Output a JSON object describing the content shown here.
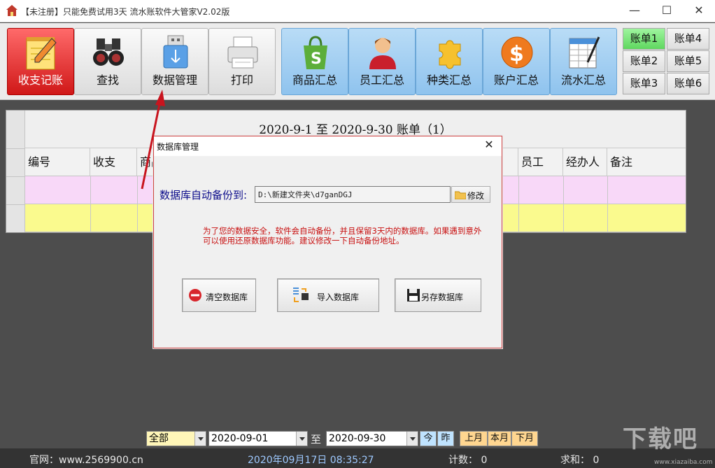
{
  "window": {
    "title": "【未注册】只能免费试用3天 流水账软件大管家V2.02版",
    "min_glyph": "—",
    "max_glyph": "☐",
    "close_glyph": "✕"
  },
  "toolbar": {
    "buttons": [
      {
        "label": "收支记账",
        "icon": "notepad-pencil-icon"
      },
      {
        "label": "查找",
        "icon": "binoculars-icon"
      },
      {
        "label": "数据管理",
        "icon": "usb-drive-icon"
      },
      {
        "label": "打印",
        "icon": "printer-icon"
      },
      {
        "label": "商品汇总",
        "icon": "shopping-bag-icon"
      },
      {
        "label": "员工汇总",
        "icon": "person-icon"
      },
      {
        "label": "种类汇总",
        "icon": "puzzle-icon"
      },
      {
        "label": "账户汇总",
        "icon": "dollar-coin-icon"
      },
      {
        "label": "流水汇总",
        "icon": "spreadsheet-icon"
      }
    ],
    "accounts": [
      "账单1",
      "账单2",
      "账单3",
      "账单4",
      "账单5",
      "账单6"
    ],
    "selected_account": "账单1"
  },
  "grid": {
    "title": "2020-9-1 至 2020-9-30 账单（1）",
    "columns": [
      "编号",
      "收支",
      "商品",
      "员工",
      "经办人",
      "备注"
    ]
  },
  "dialog": {
    "title": "数据库管理",
    "close_glyph": "✕",
    "backup_label": "数据库自动备份到:",
    "backup_path": "D:\\新建文件夹\\d7ganDGJ",
    "modify_label": "修改",
    "warning": "为了您的数据安全，软件会自动备份，并且保留3天内的数据库。如果遇到意外可以使用还原数据库功能。建议修改一下自动备份地址。",
    "clear_label": "清空数据库",
    "import_label": "导入数据库",
    "save_label": "另存数据库"
  },
  "filter": {
    "category": "全部",
    "from_date": "2020-09-01",
    "to_label": "至",
    "to_date": "2020-09-30",
    "today": "今",
    "yesterday": "昨",
    "prev_month": "上月",
    "this_month": "本月",
    "next_month": "下月"
  },
  "status": {
    "website": "官网：www.2569900.cn",
    "datetime": "2020年09月17日  08:35:27",
    "count": "计数：  0",
    "sum": "求和：  0"
  },
  "watermark": {
    "text": "下载吧",
    "sub": "www.xiazaiba.com"
  },
  "colors": {
    "active_button": "#d01818",
    "selected_account": "#5fd85f",
    "row_pink": "#f8d8f8",
    "row_yellow": "#fafa8e",
    "warning_text": "#c81010",
    "annotation_arrow": "#c8141e"
  }
}
